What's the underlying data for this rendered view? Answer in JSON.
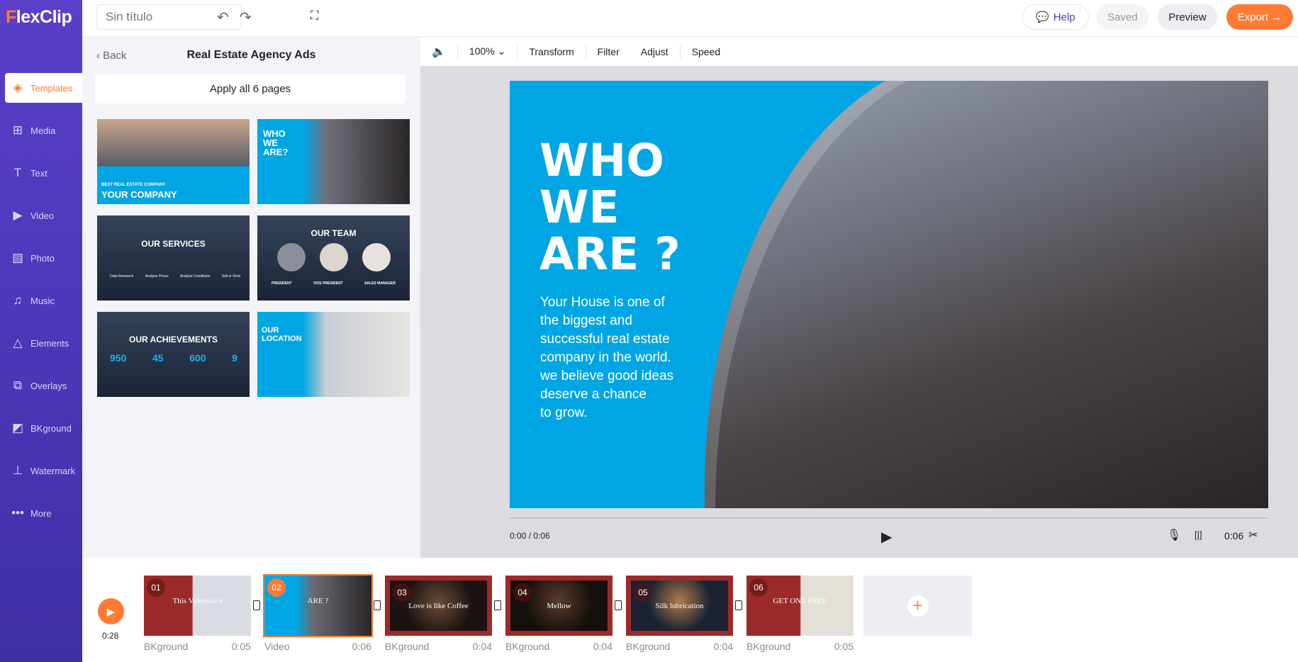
{
  "app": {
    "logo": "FlexClip",
    "title_value": "Sin título"
  },
  "sidebar": {
    "items": [
      {
        "label": "Templates",
        "icon": "layers-icon",
        "active": true
      },
      {
        "label": "Media",
        "icon": "folder-plus-icon"
      },
      {
        "label": "Text",
        "icon": "text-icon"
      },
      {
        "label": "Video",
        "icon": "video-icon"
      },
      {
        "label": "Photo",
        "icon": "photo-icon"
      },
      {
        "label": "Music",
        "icon": "music-icon"
      },
      {
        "label": "Elements",
        "icon": "elements-icon"
      },
      {
        "label": "Overlays",
        "icon": "overlays-icon"
      },
      {
        "label": "BKground",
        "icon": "background-icon"
      },
      {
        "label": "Watermark",
        "icon": "stamp-icon"
      },
      {
        "label": "More",
        "icon": "more-icon"
      }
    ]
  },
  "header": {
    "help": "Help",
    "saved": "Saved",
    "preview": "Preview",
    "export": "Export →",
    "accent": "#ff7a35"
  },
  "panel": {
    "back": "Back",
    "title": "Real Estate Agency Ads",
    "apply": "Apply all 6 pages",
    "thumbs": [
      {
        "small": "BEST REAL ESTATE COMPANY",
        "big": "YOUR COMPANY"
      },
      {
        "big": "WHO WE ARE?"
      },
      {
        "big": "OUR SERVICES",
        "items": [
          "Data Research",
          "Analyse Prices",
          "Analyse Conditions",
          "Sell or Rent"
        ]
      },
      {
        "big": "OUR TEAM",
        "items": [
          "PRESIDENT",
          "VICE PRESIDENT",
          "SALES MANAGER"
        ]
      },
      {
        "big": "OUR ACHIEVEMENTS",
        "stats": [
          "950",
          "45",
          "600",
          "9"
        ]
      },
      {
        "big": "OUR LOCATION"
      }
    ]
  },
  "toolbar": {
    "zoom": "100%",
    "transform": "Transform",
    "filter": "Filter",
    "adjust": "Adjust",
    "speed": "Speed"
  },
  "canvas": {
    "heading": "WHO\nWE\nARE ?",
    "body": "Your House is one of\nthe biggest and\nsuccessful real estate\ncompany in the world.\nwe believe good ideas\ndeserve a chance\nto grow.",
    "brand_blue": "#00a6e4"
  },
  "player": {
    "time": "0:00 / 0:06",
    "clip_duration": "0:06",
    "progress": 0
  },
  "timeline": {
    "total": "0:28",
    "clips": [
      {
        "num": "01",
        "text": "This Valentine's",
        "type": "BKground",
        "duration": "0:05"
      },
      {
        "num": "02",
        "text": "ARE ?",
        "type": "Video",
        "duration": "0:06",
        "selected": true
      },
      {
        "num": "03",
        "text": "Love is like Coffee",
        "type": "BKground",
        "duration": "0:04"
      },
      {
        "num": "04",
        "text": "Mellow",
        "type": "BKground",
        "duration": "0:04"
      },
      {
        "num": "05",
        "text": "Silk lubrication",
        "type": "BKground",
        "duration": "0:04"
      },
      {
        "num": "06",
        "text": "GET ONE FREE",
        "type": "BKground",
        "duration": "0:05"
      }
    ]
  }
}
